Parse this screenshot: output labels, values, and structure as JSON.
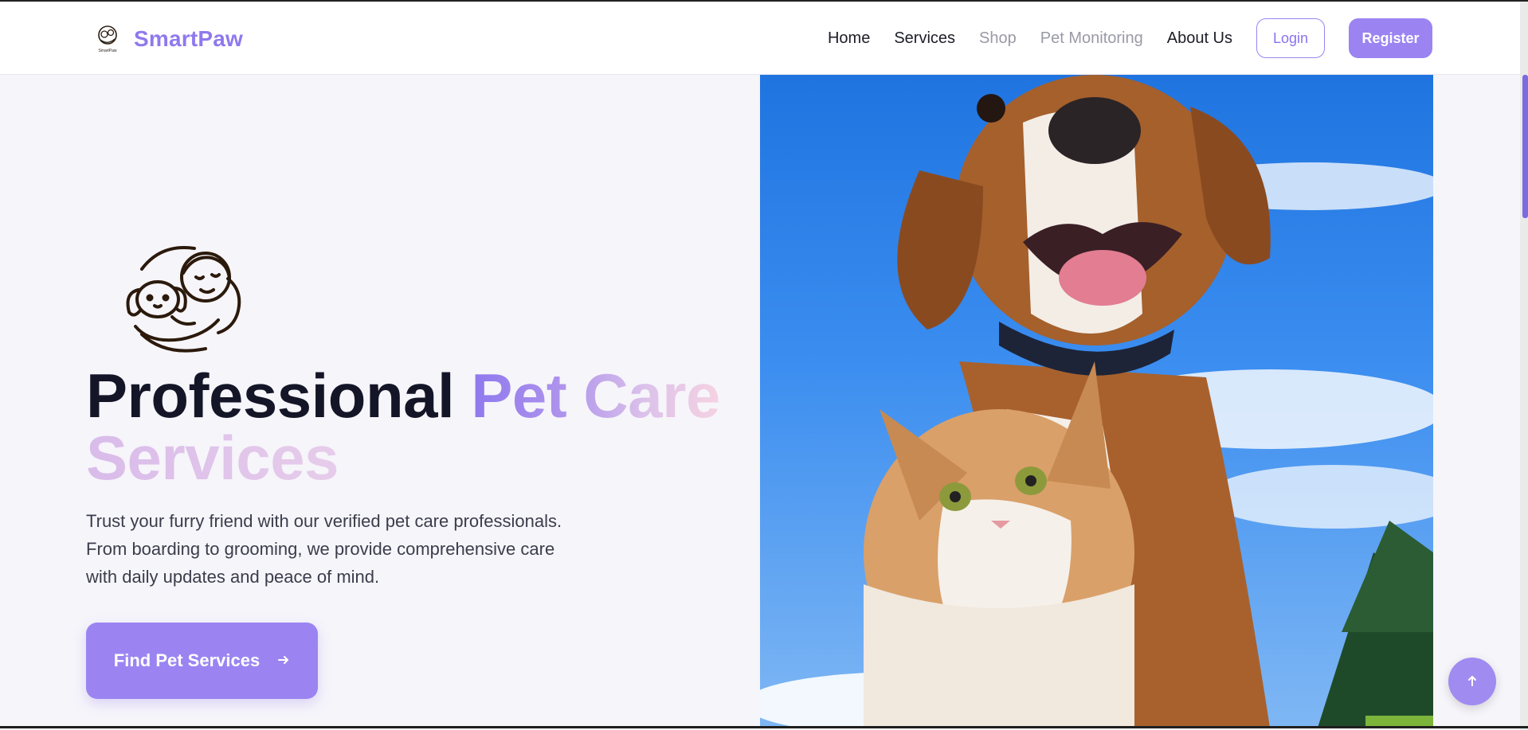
{
  "brand": {
    "name": "SmartPaw",
    "logo_text": "SmartPaw"
  },
  "nav": {
    "links": [
      "Home",
      "Services",
      "Shop",
      "Pet Monitoring",
      "About Us"
    ],
    "login_label": "Login",
    "register_label": "Register"
  },
  "hero": {
    "title_part1": "Professional",
    "title_part2": "Pet Care",
    "title_part3": "Services",
    "description": "Trust your furry friend with our verified pet care professionals. From boarding to grooming, we provide comprehensive care with daily updates and peace of mind.",
    "cta_label": "Find Pet Services",
    "cta_icon": "arrow-right-icon",
    "illustration": "person-hugging-dog-icon",
    "photo": "beagle-and-kitten-photo"
  },
  "scroll_top_icon": "arrow-up-icon",
  "colors": {
    "accent": "#9b84f2",
    "brand_text": "#9079ee",
    "heading": "#141628",
    "body_text": "#3b3d4c",
    "background": "#f6f5fa"
  }
}
